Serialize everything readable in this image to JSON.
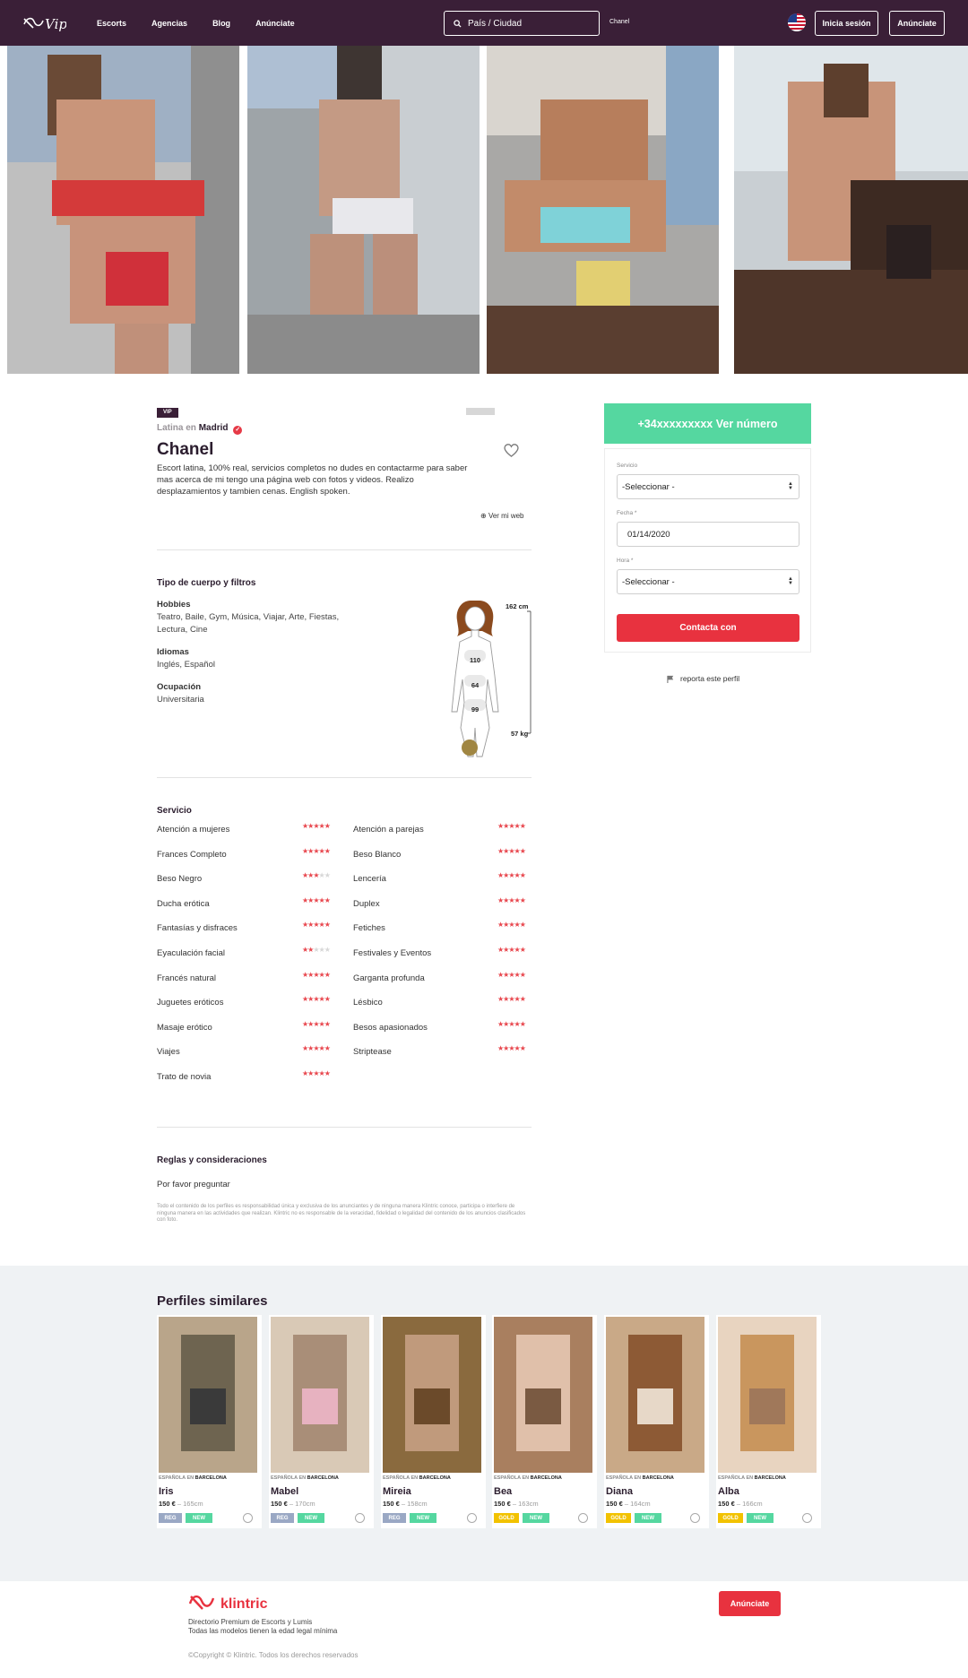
{
  "header": {
    "nav": [
      "Escorts",
      "Agencias",
      "Blog",
      "Anúnciate"
    ],
    "search_placeholder": "País / Ciudad",
    "search_tag": "Chanel",
    "login_label": "Inicia sesión",
    "advertise_label": "Anúnciate",
    "flag_icon": "us-flag-icon"
  },
  "profile": {
    "badge": "VIP",
    "category": "Latina en",
    "city": "Madrid",
    "name": "Chanel",
    "description": "Escort latina, 100% real, servicios completos no dudes en contactarme para saber mas acerca de mi tengo una página web con fotos y videos. Realizo desplazamientos y tambien cenas. English spoken.",
    "web_link": "Ver mi web"
  },
  "body": {
    "section_title": "Tipo de cuerpo y filtros",
    "hobbies_label": "Hobbies",
    "hobbies": "Teatro, Baile, Gym, Música, Viajar, Arte, Fiestas, Lectura, Cine",
    "languages_label": "Idiomas",
    "languages": "Inglés, Español",
    "occupation_label": "Ocupación",
    "occupation": "Universitaria",
    "height": "162 cm",
    "weight": "57 kg",
    "bust": "110",
    "waist": "64",
    "hips": "99"
  },
  "services": {
    "title": "Servicio",
    "left": [
      {
        "label": "Atención a mujeres",
        "stars": 5
      },
      {
        "label": "Frances Completo",
        "stars": 5
      },
      {
        "label": "Beso Negro",
        "stars": 3
      },
      {
        "label": "Ducha erótica",
        "stars": 5
      },
      {
        "label": "Fantasías y disfraces",
        "stars": 5
      },
      {
        "label": "Eyaculación facial",
        "stars": 2
      },
      {
        "label": "Francés natural",
        "stars": 5
      },
      {
        "label": "Juguetes eróticos",
        "stars": 5
      },
      {
        "label": "Masaje erótico",
        "stars": 5
      },
      {
        "label": "Viajes",
        "stars": 5
      },
      {
        "label": "Trato de novia",
        "stars": 5
      }
    ],
    "right": [
      {
        "label": "Atención a parejas",
        "stars": 5
      },
      {
        "label": "Beso Blanco",
        "stars": 5
      },
      {
        "label": "Lencería",
        "stars": 5
      },
      {
        "label": "Duplex",
        "stars": 5
      },
      {
        "label": "Fetiches",
        "stars": 5
      },
      {
        "label": "Festivales y Eventos",
        "stars": 5
      },
      {
        "label": "Garganta profunda",
        "stars": 5
      },
      {
        "label": "Lésbico",
        "stars": 5
      },
      {
        "label": "Besos apasionados",
        "stars": 5
      },
      {
        "label": "Striptease",
        "stars": 5
      }
    ]
  },
  "rules": {
    "title": "Reglas y consideraciones",
    "text": "Por favor preguntar",
    "disclaimer": "Todo el contenido de los perfiles es responsabilidad única y exclusiva de los anunciantes y de ninguna manera Klintric conoce, participa o interfiere de ninguna manera en las actividades que realizan. Klintric no es responsable de la veracidad, fidelidad o legalidad del contenido de los anuncios clasificados con foto."
  },
  "booking": {
    "phone_button": "+34xxxxxxxxx Ver número",
    "service_label": "Servicio",
    "service_value": "-Seleccionar -",
    "date_label": "Fecha *",
    "date_value": "01/14/2020",
    "time_label": "Hora *",
    "time_value": "-Seleccionar -",
    "contact_button": "Contacta con",
    "report_label": "reporta este perfil"
  },
  "similar": {
    "title": "Perfiles similares",
    "items": [
      {
        "loc": "ESPAÑOLA EN",
        "city": "BARCELONA",
        "name": "Iris",
        "price": "150 €",
        "height": "165cm",
        "badge": "REG",
        "badge_color": "#9aa8c4",
        "new": "NEW"
      },
      {
        "loc": "ESPAÑOLA EN",
        "city": "BARCELONA",
        "name": "Mabel",
        "price": "150 €",
        "height": "170cm",
        "badge": "REG",
        "badge_color": "#9aa8c4",
        "new": "NEW"
      },
      {
        "loc": "ESPAÑOLA EN",
        "city": "BARCELONA",
        "name": "Mireia",
        "price": "150 €",
        "height": "158cm",
        "badge": "REG",
        "badge_color": "#9aa8c4",
        "new": "NEW"
      },
      {
        "loc": "ESPAÑOLA EN",
        "city": "BARCELONA",
        "name": "Bea",
        "price": "150 €",
        "height": "163cm",
        "badge": "GOLD",
        "badge_color": "#f2c200",
        "new": "NEW"
      },
      {
        "loc": "ESPAÑOLA EN",
        "city": "BARCELONA",
        "name": "Diana",
        "price": "150 €",
        "height": "164cm",
        "badge": "GOLD",
        "badge_color": "#f2c200",
        "new": "NEW"
      },
      {
        "loc": "ESPAÑOLA EN",
        "city": "BARCELONA",
        "name": "Alba",
        "price": "150 €",
        "height": "166cm",
        "badge": "GOLD",
        "badge_color": "#f2c200",
        "new": "NEW"
      }
    ]
  },
  "footer": {
    "brand": "klintric",
    "line1": "Directorio Premium de Escorts y Lumis",
    "line2": "Todas las modelos tienen la edad legal mínima",
    "button": "Anúnciate",
    "copyright": "©Copyright © Klintric. Todos los derechos reservados"
  },
  "colors": {
    "brand": "#3a1f37",
    "accent_red": "#e8323f",
    "accent_green": "#55d7a0",
    "new_badge": "#55d7a0"
  }
}
